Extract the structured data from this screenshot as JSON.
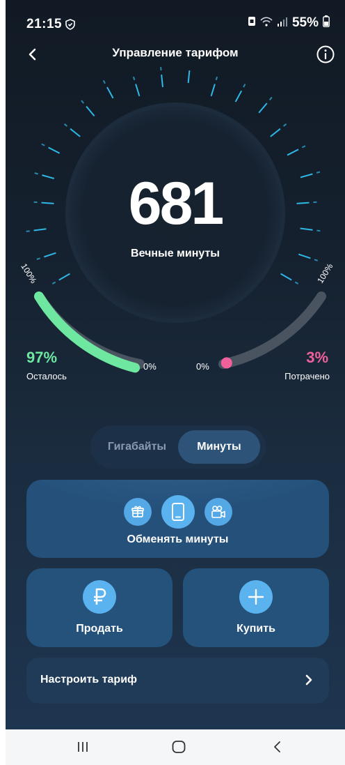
{
  "status": {
    "time": "21:15",
    "battery": "55%"
  },
  "header": {
    "title": "Управление тарифом"
  },
  "gauge": {
    "value": "681",
    "label": "Вечные минуты",
    "left": {
      "percent": "97%",
      "caption": "Осталось",
      "min": "0%",
      "max": "100%",
      "fraction": 0.97
    },
    "right": {
      "percent": "3%",
      "caption": "Потрачено",
      "min": "0%",
      "max": "100%",
      "fraction": 0.03
    },
    "colors": {
      "remaining": "#6ee7a0",
      "spent": "#f0609b"
    }
  },
  "tabs": [
    {
      "label": "Гигабайты",
      "active": false
    },
    {
      "label": "Минуты",
      "active": true
    }
  ],
  "actions": {
    "exchange": "Обменять минуты",
    "exchange_icons": [
      "gift-icon",
      "phone-icon",
      "video-icon"
    ],
    "sell": "Продать",
    "sell_icon": "ruble-icon",
    "buy": "Купить",
    "buy_icon": "plus-icon",
    "setup": "Настроить тариф"
  }
}
